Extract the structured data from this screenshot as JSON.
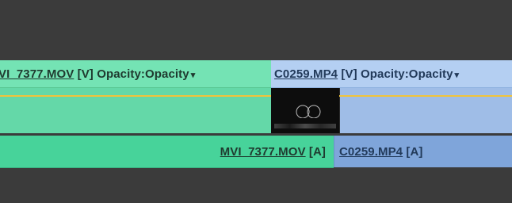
{
  "video_track": {
    "clip1": {
      "filename": "VI_7377.MOV",
      "track_tag": "[V]",
      "effect": "Opacity:Opacity"
    },
    "clip2": {
      "filename": "C0259.MP4",
      "track_tag": "[V]",
      "effect": "Opacity:Opacity"
    }
  },
  "audio_track": {
    "clip1": {
      "filename": "MVI_7377.MOV",
      "track_tag": "[A]"
    },
    "clip2": {
      "filename": "C0259.MP4",
      "track_tag": "[A]"
    }
  },
  "colors": {
    "clip_green": "#5fd3a2",
    "clip_blue": "#a7c3ea",
    "opacity_line": "#f0c33c",
    "background": "#3b3b3b"
  },
  "icons": {
    "effect_dropdown": "chevron-down-icon"
  }
}
